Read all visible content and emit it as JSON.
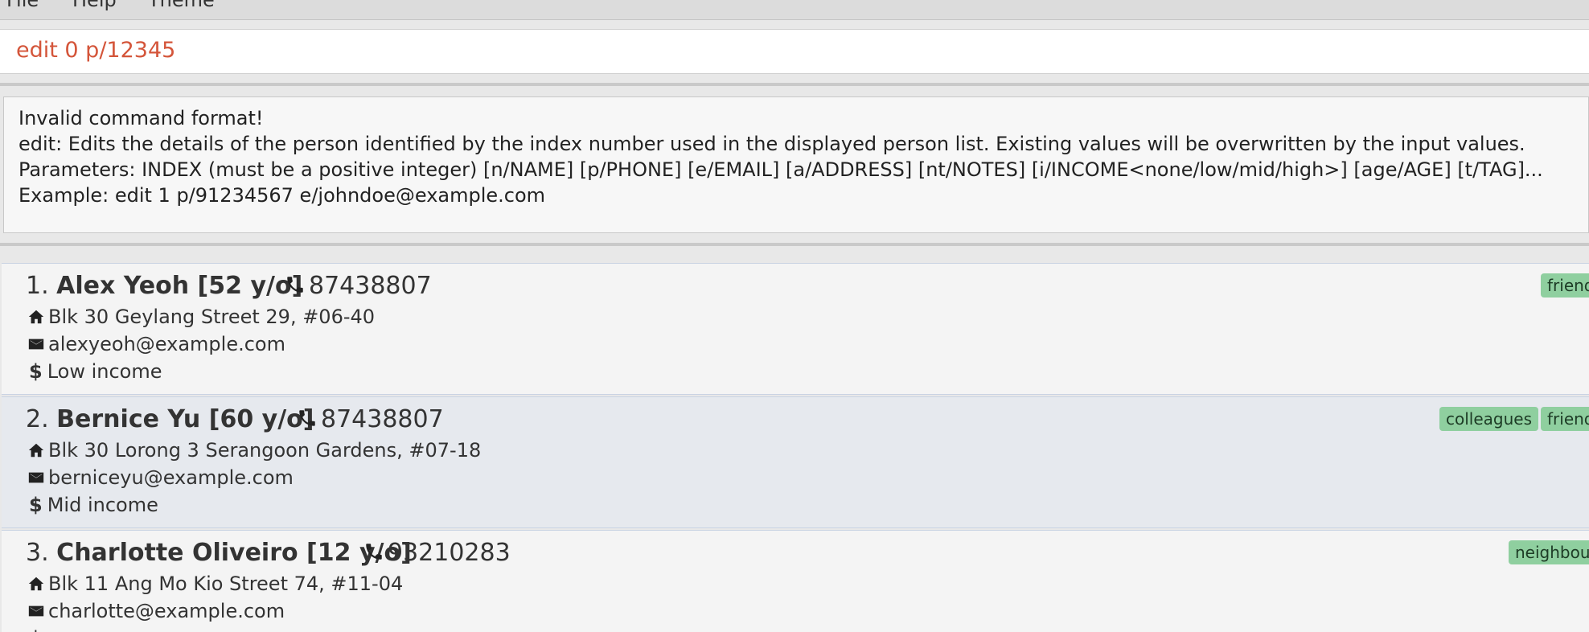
{
  "menu": [
    "File",
    "Help",
    "Theme"
  ],
  "command": {
    "value": "edit 0 p/12345"
  },
  "result": {
    "lines": [
      "Invalid command format!",
      "edit: Edits the details of the person identified by the index number used in the displayed person list. Existing values will be overwritten by the input values.",
      "Parameters: INDEX (must be a positive integer) [n/NAME] [p/PHONE] [e/EMAIL] [a/ADDRESS] [nt/NOTES] [i/INCOME<none/low/mid/high>] [age/AGE] [t/TAG]...",
      "Example: edit 1 p/91234567 e/johndoe@example.com"
    ]
  },
  "persons": [
    {
      "index": "1. ",
      "name": "Alex Yeoh [52 y/o]",
      "phone": "87438807",
      "address": "Blk 30 Geylang Street 29, #06-40",
      "email": "alexyeoh@example.com",
      "income": "Low income",
      "tags": [
        "friends"
      ]
    },
    {
      "index": "2. ",
      "name": "Bernice Yu [60 y/o]",
      "phone": "87438807",
      "address": "Blk 30 Lorong 3 Serangoon Gardens, #07-18",
      "email": "berniceyu@example.com",
      "income": "Mid income",
      "tags": [
        "colleagues",
        "friends"
      ]
    },
    {
      "index": "3. ",
      "name": "Charlotte Oliveiro [12 y/o]",
      "phone": "93210283",
      "address": "Blk 11 Ang Mo Kio Street 74, #11-04",
      "email": "charlotte@example.com",
      "income": "",
      "tags": [
        "neighbours"
      ]
    }
  ],
  "icons": {
    "phone": "phone-icon",
    "address": "home-icon",
    "email": "mail-icon",
    "income": "dollar-icon"
  },
  "colors": {
    "command_text": "#d4553a",
    "tag_bg": "#8fcf9f"
  }
}
